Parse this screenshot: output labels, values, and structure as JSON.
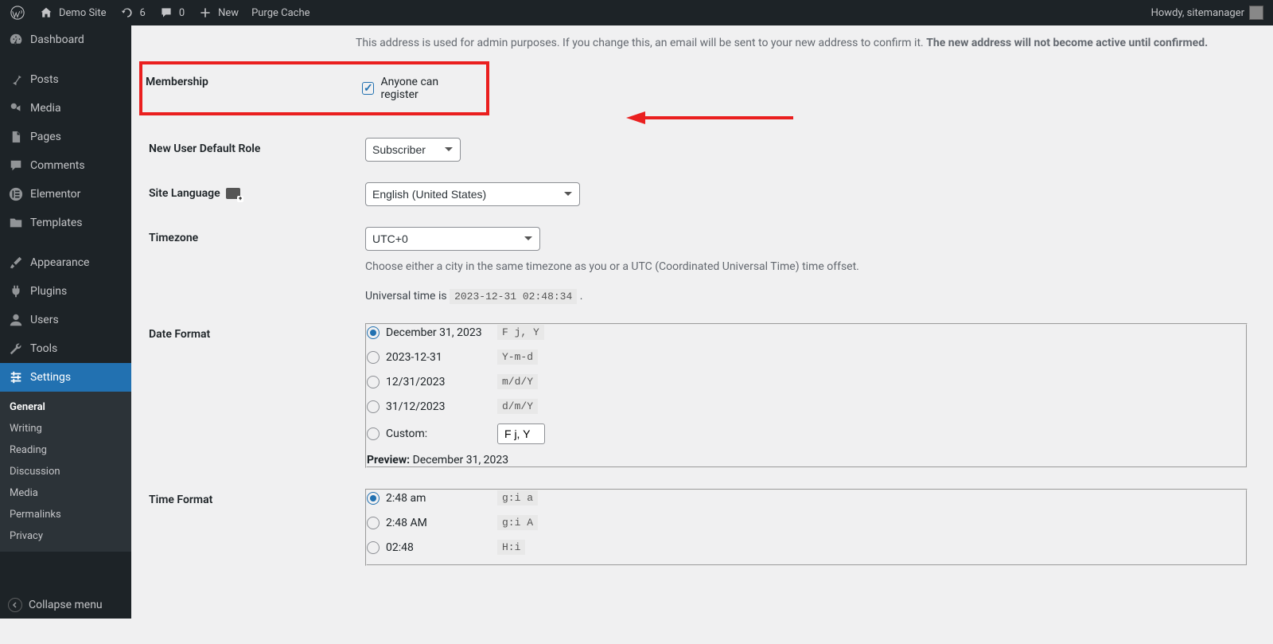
{
  "adminbar": {
    "site_name": "Demo Site",
    "updates_count": "6",
    "comments_count": "0",
    "new_label": "New",
    "purge_label": "Purge Cache",
    "howdy": "Howdy, sitemanager"
  },
  "sidebar": {
    "items": [
      {
        "label": "Dashboard"
      },
      {
        "label": "Posts"
      },
      {
        "label": "Media"
      },
      {
        "label": "Pages"
      },
      {
        "label": "Comments"
      },
      {
        "label": "Elementor"
      },
      {
        "label": "Templates"
      },
      {
        "label": "Appearance"
      },
      {
        "label": "Plugins"
      },
      {
        "label": "Users"
      },
      {
        "label": "Tools"
      },
      {
        "label": "Settings"
      }
    ],
    "submenu": [
      {
        "label": "General"
      },
      {
        "label": "Writing"
      },
      {
        "label": "Reading"
      },
      {
        "label": "Discussion"
      },
      {
        "label": "Media"
      },
      {
        "label": "Permalinks"
      },
      {
        "label": "Privacy"
      }
    ],
    "collapse": "Collapse menu"
  },
  "settings": {
    "intro_desc_1": "This address is used for admin purposes. If you change this, an email will be sent to your new address to confirm it. ",
    "intro_desc_2": "The new address will not become active until confirmed.",
    "membership_label": "Membership",
    "membership_checkbox": "Anyone can register",
    "default_role_label": "New User Default Role",
    "default_role_value": "Subscriber",
    "site_language_label": "Site Language",
    "site_language_value": "English (United States)",
    "timezone_label": "Timezone",
    "timezone_value": "UTC+0",
    "timezone_desc": "Choose either a city in the same timezone as you or a UTC (Coordinated Universal Time) time offset.",
    "universal_time_prefix": "Universal time is ",
    "universal_time_value": "2023-12-31 02:48:34",
    "date_format_label": "Date Format",
    "date_options": [
      {
        "label": "December 31, 2023",
        "code": "F j, Y"
      },
      {
        "label": "2023-12-31",
        "code": "Y-m-d"
      },
      {
        "label": "12/31/2023",
        "code": "m/d/Y"
      },
      {
        "label": "31/12/2023",
        "code": "d/m/Y"
      }
    ],
    "date_custom_label": "Custom:",
    "date_custom_value": "F j, Y",
    "preview_label": "Preview:",
    "preview_value": "December 31, 2023",
    "time_format_label": "Time Format",
    "time_options": [
      {
        "label": "2:48 am",
        "code": "g:i a"
      },
      {
        "label": "2:48 AM",
        "code": "g:i A"
      },
      {
        "label": "02:48",
        "code": "H:i"
      }
    ]
  }
}
